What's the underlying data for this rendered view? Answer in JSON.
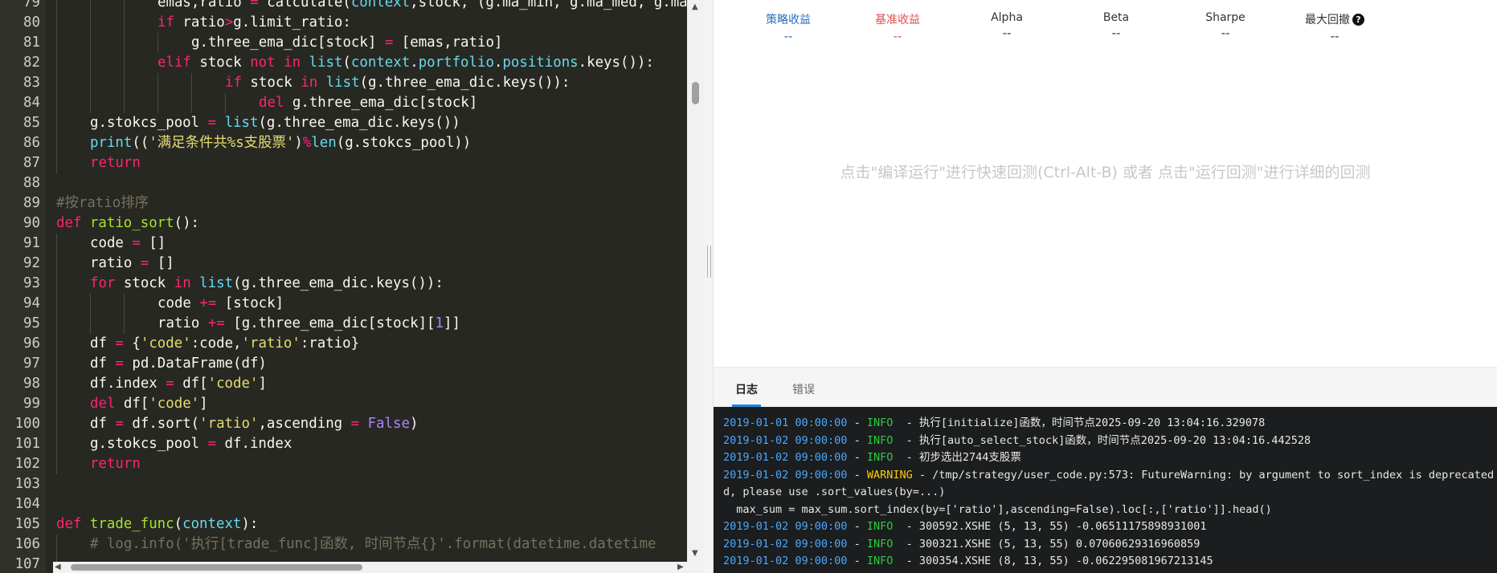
{
  "editor": {
    "lines": [
      {
        "n": "79",
        "g": 3,
        "t": [
          [
            "emas,ratio ",
            ""
          ],
          [
            "=",
            "kw"
          ],
          [
            " calculate(",
            ""
          ],
          [
            "context",
            "bi"
          ],
          [
            ",stock, (g.ma_min, g.ma_med, g.ma_max",
            ""
          ]
        ]
      },
      {
        "n": "80",
        "g": 3,
        "t": [
          [
            "if",
            "kw"
          ],
          [
            " ratio",
            ""
          ],
          [
            ">",
            "kw"
          ],
          [
            "g.limit_ratio:",
            ""
          ]
        ]
      },
      {
        "n": "81",
        "g": 4,
        "t": [
          [
            "g.three_ema_dic[stock] ",
            ""
          ],
          [
            "=",
            "kw"
          ],
          [
            " [emas,ratio]",
            ""
          ]
        ]
      },
      {
        "n": "82",
        "g": 3,
        "t": [
          [
            "elif",
            "kw"
          ],
          [
            " stock ",
            ""
          ],
          [
            "not",
            "kw"
          ],
          [
            " ",
            ""
          ],
          [
            "in",
            "kw"
          ],
          [
            " ",
            ""
          ],
          [
            "list",
            "bi"
          ],
          [
            "(",
            ""
          ],
          [
            "context",
            "bi"
          ],
          [
            ".",
            ""
          ],
          [
            "portfolio",
            "bi"
          ],
          [
            ".",
            ""
          ],
          [
            "positions",
            "bi"
          ],
          [
            ".keys()):",
            ""
          ]
        ]
      },
      {
        "n": "83",
        "g": 5,
        "t": [
          [
            "if",
            "kw"
          ],
          [
            " stock ",
            ""
          ],
          [
            "in",
            "kw"
          ],
          [
            " ",
            ""
          ],
          [
            "list",
            "bi"
          ],
          [
            "(g.three_ema_dic.keys()):",
            ""
          ]
        ]
      },
      {
        "n": "84",
        "g": 6,
        "t": [
          [
            "del",
            "kw"
          ],
          [
            " g.three_ema_dic[stock]",
            ""
          ]
        ]
      },
      {
        "n": "85",
        "g": 1,
        "t": [
          [
            "g.stokcs_pool ",
            ""
          ],
          [
            "=",
            "kw"
          ],
          [
            " ",
            ""
          ],
          [
            "list",
            "bi"
          ],
          [
            "(g.three_ema_dic.keys())",
            ""
          ]
        ]
      },
      {
        "n": "86",
        "g": 1,
        "t": [
          [
            "print",
            "bi"
          ],
          [
            "((",
            ""
          ],
          [
            "'满足条件共%s支股票'",
            "st"
          ],
          [
            ")",
            ""
          ],
          [
            "%",
            "kw"
          ],
          [
            "len",
            "bi"
          ],
          [
            "(g.stokcs_pool))",
            ""
          ]
        ]
      },
      {
        "n": "87",
        "g": 1,
        "t": [
          [
            "return",
            "kw"
          ]
        ]
      },
      {
        "n": "88",
        "g": 0,
        "t": []
      },
      {
        "n": "89",
        "g": 0,
        "t": [
          [
            "#按ratio排序",
            "cm"
          ]
        ]
      },
      {
        "n": "90",
        "g": 0,
        "t": [
          [
            "def",
            "kw"
          ],
          [
            " ",
            ""
          ],
          [
            "ratio_sort",
            "fn"
          ],
          [
            "():",
            ""
          ]
        ]
      },
      {
        "n": "91",
        "g": 1,
        "t": [
          [
            "code ",
            ""
          ],
          [
            "=",
            "kw"
          ],
          [
            " []",
            ""
          ]
        ]
      },
      {
        "n": "92",
        "g": 1,
        "t": [
          [
            "ratio ",
            ""
          ],
          [
            "=",
            "kw"
          ],
          [
            " []",
            ""
          ]
        ]
      },
      {
        "n": "93",
        "g": 1,
        "t": [
          [
            "for",
            "kw"
          ],
          [
            " stock ",
            ""
          ],
          [
            "in",
            "kw"
          ],
          [
            " ",
            ""
          ],
          [
            "list",
            "bi"
          ],
          [
            "(g.three_ema_dic.keys()):",
            ""
          ]
        ]
      },
      {
        "n": "94",
        "g": 3,
        "t": [
          [
            "code ",
            ""
          ],
          [
            "+=",
            "kw"
          ],
          [
            " [stock]",
            ""
          ]
        ]
      },
      {
        "n": "95",
        "g": 3,
        "t": [
          [
            "ratio ",
            ""
          ],
          [
            "+=",
            "kw"
          ],
          [
            " [g.three_ema_dic[stock][",
            ""
          ],
          [
            "1",
            "nu"
          ],
          [
            "]]",
            ""
          ]
        ]
      },
      {
        "n": "96",
        "g": 1,
        "t": [
          [
            "df ",
            ""
          ],
          [
            "=",
            "kw"
          ],
          [
            " {",
            ""
          ],
          [
            "'code'",
            "st"
          ],
          [
            ":code,",
            ""
          ],
          [
            "'ratio'",
            "st"
          ],
          [
            ":ratio}",
            ""
          ]
        ]
      },
      {
        "n": "97",
        "g": 1,
        "t": [
          [
            "df ",
            ""
          ],
          [
            "=",
            "kw"
          ],
          [
            " pd.DataFrame(df)",
            ""
          ]
        ]
      },
      {
        "n": "98",
        "g": 1,
        "t": [
          [
            "df.index ",
            ""
          ],
          [
            "=",
            "kw"
          ],
          [
            " df[",
            ""
          ],
          [
            "'code'",
            "st"
          ],
          [
            "]",
            ""
          ]
        ]
      },
      {
        "n": "99",
        "g": 1,
        "t": [
          [
            "del",
            "kw"
          ],
          [
            " df[",
            ""
          ],
          [
            "'code'",
            "st"
          ],
          [
            "]",
            ""
          ]
        ]
      },
      {
        "n": "100",
        "g": 1,
        "t": [
          [
            "df ",
            ""
          ],
          [
            "=",
            "kw"
          ],
          [
            " df.sort(",
            ""
          ],
          [
            "'ratio'",
            "st"
          ],
          [
            ",ascending ",
            ""
          ],
          [
            "=",
            "kw"
          ],
          [
            " ",
            ""
          ],
          [
            "False",
            "nu"
          ],
          [
            ")",
            ""
          ]
        ]
      },
      {
        "n": "101",
        "g": 1,
        "t": [
          [
            "g.stokcs_pool ",
            ""
          ],
          [
            "=",
            "kw"
          ],
          [
            " df.index",
            ""
          ]
        ]
      },
      {
        "n": "102",
        "g": 1,
        "t": [
          [
            "return",
            "kw"
          ]
        ]
      },
      {
        "n": "103",
        "g": 0,
        "t": []
      },
      {
        "n": "104",
        "g": 0,
        "t": []
      },
      {
        "n": "105",
        "g": 0,
        "t": [
          [
            "def",
            "kw"
          ],
          [
            " ",
            ""
          ],
          [
            "trade_func",
            "fn"
          ],
          [
            "(",
            ""
          ],
          [
            "context",
            "bi"
          ],
          [
            "):",
            ""
          ]
        ]
      },
      {
        "n": "106",
        "g": 1,
        "t": [
          [
            "# log.info('执行[trade_func]函数, 时间节点{}'.format(datetime.datetime",
            "cm"
          ]
        ]
      },
      {
        "n": "107",
        "g": 1,
        "t": []
      }
    ]
  },
  "metrics": [
    {
      "label": "策略收益",
      "value": "--",
      "color": "#2a6ebb"
    },
    {
      "label": "基准收益",
      "value": "--",
      "color": "#d9534f"
    },
    {
      "label": "Alpha",
      "value": "--",
      "color": "#333333"
    },
    {
      "label": "Beta",
      "value": "--",
      "color": "#333333"
    },
    {
      "label": "Sharpe",
      "value": "--",
      "color": "#333333"
    },
    {
      "label": "最大回撤",
      "value": "--",
      "color": "#333333"
    }
  ],
  "help_glyph": "?",
  "hint": "点击\"编译运行\"进行快速回测(Ctrl-Alt-B) 或者 点击\"运行回测\"进行详细的回测",
  "tabs": {
    "log": "日志",
    "error": "错误"
  },
  "log": [
    {
      "ts": "2019-01-01 00:00:00",
      "sep": " - ",
      "lvl": "INFO",
      "msg": "  - 执行[initialize]函数，时间节点2025-09-20 13:04:16.329078"
    },
    {
      "ts": "2019-01-02 09:00:00",
      "sep": " - ",
      "lvl": "INFO",
      "msg": "  - 执行[auto_select_stock]函数，时间节点2025-09-20 13:04:16.442528"
    },
    {
      "ts": "2019-01-02 09:00:00",
      "sep": " - ",
      "lvl": "INFO",
      "msg": "  - 初步选出2744支股票"
    },
    {
      "ts": "2019-01-02 09:00:00",
      "sep": " - ",
      "lvl": "WARNING",
      "msg": " - /tmp/strategy/user_code.py:573: FutureWarning: by argument to sort_index is deprecated"
    },
    {
      "ts": "",
      "sep": "",
      "lvl": "",
      "msg": "d, please use .sort_values(by=...)"
    },
    {
      "ts": "",
      "sep": "",
      "lvl": "",
      "msg": "  max_sum = max_sum.sort_index(by=['ratio'],ascending=False).loc[:,['ratio']].head()"
    },
    {
      "ts": "2019-01-02 09:00:00",
      "sep": " - ",
      "lvl": "INFO",
      "msg": "  - 300592.XSHE (5, 13, 55) -0.06511175898931001"
    },
    {
      "ts": "2019-01-02 09:00:00",
      "sep": " - ",
      "lvl": "INFO",
      "msg": "  - 300321.XSHE (5, 13, 55) 0.07060629316960859"
    },
    {
      "ts": "2019-01-02 09:00:00",
      "sep": " - ",
      "lvl": "INFO",
      "msg": "  - 300354.XSHE (8, 13, 55) -0.062295081967213145"
    }
  ]
}
